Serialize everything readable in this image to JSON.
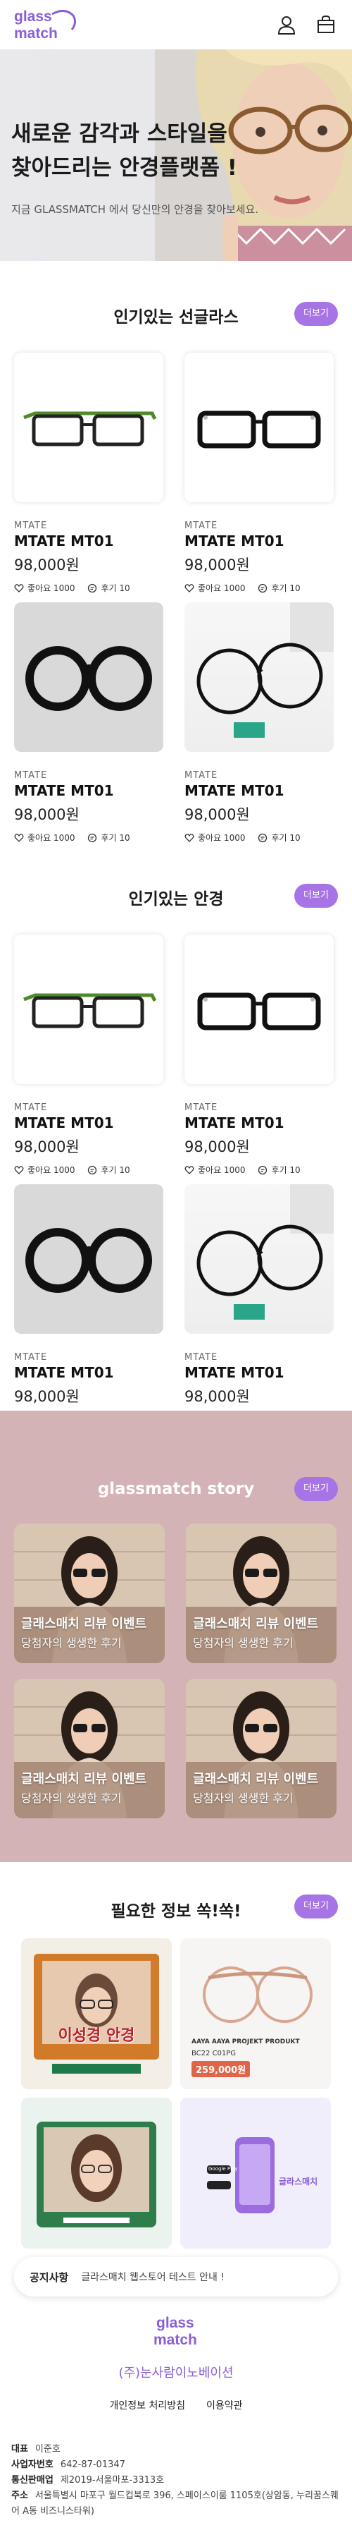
{
  "header": {
    "logo_line1": "glass",
    "logo_line2": "match",
    "icons": [
      "user-icon",
      "bag-icon"
    ]
  },
  "hero": {
    "title_line1": "새로운 감각과 스타일을",
    "title_line2": "찾아드리는 안경플랫폼 !",
    "subtitle": "지금 GLASSMATCH 에서 당신만의 안경을 찾아보세요."
  },
  "sections": {
    "sunglasses": {
      "title": "인기있는 선글라스",
      "more": "더보기"
    },
    "glasses": {
      "title": "인기있는 안경",
      "more": "더보기"
    },
    "story": {
      "title": "glassmatch story",
      "more": "더보기"
    },
    "info": {
      "title": "필요한 정보 쏙!쏙!",
      "more": "더보기"
    }
  },
  "products": [
    {
      "brand": "MTATE",
      "model": "MTATE MT01",
      "price": "98,000원",
      "likes": "좋아요 1000",
      "reviews": "후기 10"
    },
    {
      "brand": "MTATE",
      "model": "MTATE MT01",
      "price": "98,000원",
      "likes": "좋아요 1000",
      "reviews": "후기 10"
    },
    {
      "brand": "MTATE",
      "model": "MTATE MT01",
      "price": "98,000원",
      "likes": "좋아요 1000",
      "reviews": "후기 10"
    },
    {
      "brand": "MTATE",
      "model": "MTATE MT01",
      "price": "98,000원",
      "likes": "좋아요 1000",
      "reviews": "후기 10"
    }
  ],
  "story_cards": [
    {
      "line1": "글래스매치 리뷰 이벤트",
      "line2": "당첨자의 생생한 후기"
    },
    {
      "line1": "글래스매치 리뷰 이벤트",
      "line2": "당첨자의 생생한 후기"
    },
    {
      "line1": "글래스매치 리뷰 이벤트",
      "line2": "당첨자의 생생한 후기"
    },
    {
      "line1": "글래스매치 리뷰 이벤트",
      "line2": "당첨자의 생생한 후기"
    }
  ],
  "info_cards": {
    "card1_title": "이성경 안경",
    "card2_title": "AAYA AAYA PROJEKT PRODUKT",
    "card2_model": "BC22 C01PG",
    "card2_price": "259,000원",
    "card4_text": "글라스매치",
    "card4_store": "Google Play"
  },
  "notice": {
    "label": "공지사항",
    "text": "글라스매치 웹스토어 테스트 안내 !"
  },
  "footer": {
    "company": "(주)눈사람이노베이션",
    "links": [
      "개인정보 처리방침",
      "이용약관"
    ],
    "rep_label": "대표",
    "rep": "이준호",
    "biz_label": "사업자번호",
    "biz": "642-87-01347",
    "mail_label": "통신판매업",
    "mail": "제2019-서울마포-3313호",
    "addr_label": "주소",
    "addr": "서울특별시 마포구 월드컵북로 396, 스페이스이룸 1105호(상암동, 누리꿈스퀘어 A동 비즈니스타워)"
  },
  "colors": {
    "accent": "#a774e6",
    "story_bg": "#d3b3b5",
    "logo": "#8a5fd6"
  }
}
